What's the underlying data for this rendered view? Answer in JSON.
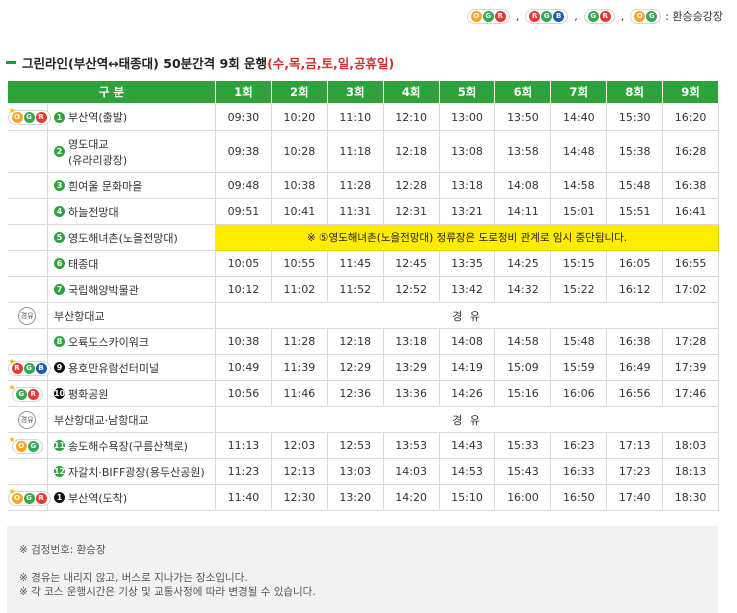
{
  "legend": {
    "groups": [
      [
        "O",
        "G",
        "R"
      ],
      [
        "R",
        "G",
        "B"
      ],
      [
        "G",
        "R"
      ],
      [
        "O",
        "G"
      ]
    ],
    "label": ": 환승승강장"
  },
  "title": {
    "main": "그린라인(부산역↔태종대) 50분간격 9회 운행",
    "days": "(수,목,금,토,일,공휴일)"
  },
  "table": {
    "header_label": "구 분",
    "runs": [
      "1회",
      "2회",
      "3회",
      "4회",
      "5회",
      "6회",
      "7회",
      "8회",
      "9회"
    ],
    "rows": [
      {
        "icon": [
          "O",
          "G",
          "R"
        ],
        "star": true,
        "num": "1",
        "numColor": "green",
        "name": "부산역(출발)",
        "times": [
          "09:30",
          "10:20",
          "11:10",
          "12:10",
          "13:00",
          "13:50",
          "14:40",
          "15:30",
          "16:20"
        ]
      },
      {
        "num": "2",
        "numColor": "green",
        "name": "영도대교\n(유라리광장)",
        "times": [
          "09:38",
          "10:28",
          "11:18",
          "12:18",
          "13:08",
          "13:58",
          "14:48",
          "15:38",
          "16:28"
        ],
        "tall": true
      },
      {
        "num": "3",
        "numColor": "green",
        "name": "흰여울 문화마을",
        "times": [
          "09:48",
          "10:38",
          "11:28",
          "12:28",
          "13:18",
          "14:08",
          "14:58",
          "15:48",
          "16:38"
        ]
      },
      {
        "num": "4",
        "numColor": "green",
        "name": "하늘전망대",
        "times": [
          "09:51",
          "10:41",
          "11:31",
          "12:31",
          "13:21",
          "14:11",
          "15:01",
          "15:51",
          "16:41"
        ]
      },
      {
        "num": "5",
        "numColor": "green",
        "name": "영도해녀촌(노을전망대)",
        "notice": "※ ⑤영도해녀촌(노을전망대) 정류장은 도로정비 관계로 임시 중단됩니다."
      },
      {
        "num": "6",
        "numColor": "green",
        "name": "태종대",
        "times": [
          "10:05",
          "10:55",
          "11:45",
          "12:45",
          "13:35",
          "14:25",
          "15:15",
          "16:05",
          "16:55"
        ]
      },
      {
        "num": "7",
        "numColor": "green",
        "name": "국립해양박물관",
        "times": [
          "10:12",
          "11:02",
          "11:52",
          "12:52",
          "13:42",
          "14:32",
          "15:22",
          "16:12",
          "17:02"
        ]
      },
      {
        "via": true,
        "viaIcon": "경유",
        "name": "부산항대교",
        "viaText": "경 유"
      },
      {
        "num": "8",
        "numColor": "green",
        "name": "오륙도스카이워크",
        "times": [
          "10:38",
          "11:28",
          "12:18",
          "13:18",
          "14:08",
          "14:58",
          "15:48",
          "16:38",
          "17:28"
        ]
      },
      {
        "icon": [
          "R",
          "G",
          "B"
        ],
        "star": true,
        "num": "9",
        "numColor": "black",
        "name": "용호만유람선터미널",
        "times": [
          "10:49",
          "11:39",
          "12:29",
          "13:29",
          "14:19",
          "15:09",
          "15:59",
          "16:49",
          "17:39"
        ]
      },
      {
        "icon": [
          "G",
          "R"
        ],
        "star": true,
        "num": "10",
        "numColor": "black",
        "name": "평화공원",
        "times": [
          "10:56",
          "11:46",
          "12:36",
          "13:36",
          "14:26",
          "15:16",
          "16:06",
          "16:56",
          "17:46"
        ]
      },
      {
        "via": true,
        "viaIcon": "경유",
        "name": "부산항대교·남항대교",
        "viaText": "경 유"
      },
      {
        "icon": [
          "O",
          "G"
        ],
        "star": true,
        "num": "11",
        "numColor": "green",
        "name": "송도해수욕장(구름산책로)",
        "times": [
          "11:13",
          "12:03",
          "12:53",
          "13:53",
          "14:43",
          "15:33",
          "16:23",
          "17:13",
          "18:03"
        ]
      },
      {
        "num": "12",
        "numColor": "green",
        "name": "자갈치·BIFF광장(용두산공원)",
        "times": [
          "11:23",
          "12:13",
          "13:03",
          "14:03",
          "14:53",
          "15:43",
          "16:33",
          "17:23",
          "18:13"
        ]
      },
      {
        "icon": [
          "O",
          "G",
          "R"
        ],
        "star": true,
        "num": "1",
        "numColor": "black",
        "name": "부산역(도착)",
        "times": [
          "11:40",
          "12:30",
          "13:20",
          "14:20",
          "15:10",
          "16:00",
          "16:50",
          "17:40",
          "18:30"
        ]
      }
    ]
  },
  "footer": {
    "note1": "※ 검정번호: 환승장",
    "note2": "※ 경유는 내리지 않고, 버스로 지나가는 장소입니다.",
    "note3": "※ 각 코스 운행시간은 기상 및 교통사정에 따라 변경될 수 있습니다."
  },
  "colors": {
    "green": "#2ea33c",
    "notice": "#ffec00",
    "days_red": "#d32f2f"
  }
}
